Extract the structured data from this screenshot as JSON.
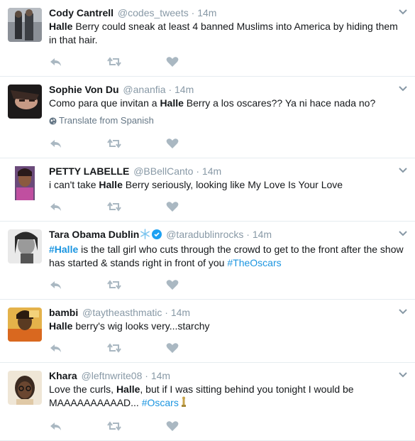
{
  "tweets": [
    {
      "name": "Cody Cantrell",
      "handle": "@codes_tweets",
      "dot": "·",
      "time": "14m",
      "text_parts": [
        {
          "t": "Halle",
          "b": true
        },
        {
          "t": " Berry could sneak at least 4 banned Muslims into America by hiding them in that hair."
        }
      ]
    },
    {
      "name": "Sophie Von Du",
      "handle": "@ananfia",
      "dot": "·",
      "time": "14m",
      "text_parts": [
        {
          "t": "Como para que invitan a "
        },
        {
          "t": "Halle",
          "b": true
        },
        {
          "t": " Berry a los oscares?? Ya ni hace nada no?"
        }
      ],
      "translate": "Translate from Spanish"
    },
    {
      "name": "PETTY LABELLE",
      "handle": "@BBellCanto",
      "dot": "·",
      "time": "14m",
      "text_parts": [
        {
          "t": "i can't take "
        },
        {
          "t": "Halle",
          "b": true
        },
        {
          "t": " Berry seriously, looking like My Love Is Your Love"
        }
      ]
    },
    {
      "name": "Tara Obama Dublin",
      "handle": "@taradublinrocks",
      "dot": "·",
      "time": "14m",
      "verified": true,
      "snowflake": true,
      "text_parts": [
        {
          "t": "#Halle",
          "link": true,
          "b": true
        },
        {
          "t": " is the tall girl who cuts through the crowd to get to the front after the show has started & stands right in front of you "
        },
        {
          "t": "#TheOscars",
          "link": true
        }
      ]
    },
    {
      "name": "bambi",
      "handle": "@taytheasthmatic",
      "dot": "·",
      "time": "14m",
      "text_parts": [
        {
          "t": "Halle",
          "b": true
        },
        {
          "t": " berry's wig looks very...starchy"
        }
      ]
    },
    {
      "name": "Khara",
      "handle": "@leftnwrite08",
      "dot": "·",
      "time": "14m",
      "trophy": true,
      "text_parts": [
        {
          "t": "Love the curls, "
        },
        {
          "t": "Halle",
          "b": true
        },
        {
          "t": ", but if I was sitting behind you tonight I would be MAAAAAAAAAAD... "
        },
        {
          "t": "#Oscars",
          "link": true
        }
      ]
    }
  ],
  "icons": {
    "reply": "reply-icon",
    "retweet": "retweet-icon",
    "like": "heart-icon",
    "more": "chevron-down-icon",
    "globe": "globe-icon",
    "verified": "verified-badge-icon",
    "snowflake": "snowflake-emoji-icon",
    "trophy": "oscar-trophy-emoji-icon"
  },
  "colors": {
    "link": "#1b95e0",
    "muted": "#8899a6",
    "text": "#14171a",
    "action_icon": "#aab8c2",
    "divider": "#e6ecf0"
  }
}
